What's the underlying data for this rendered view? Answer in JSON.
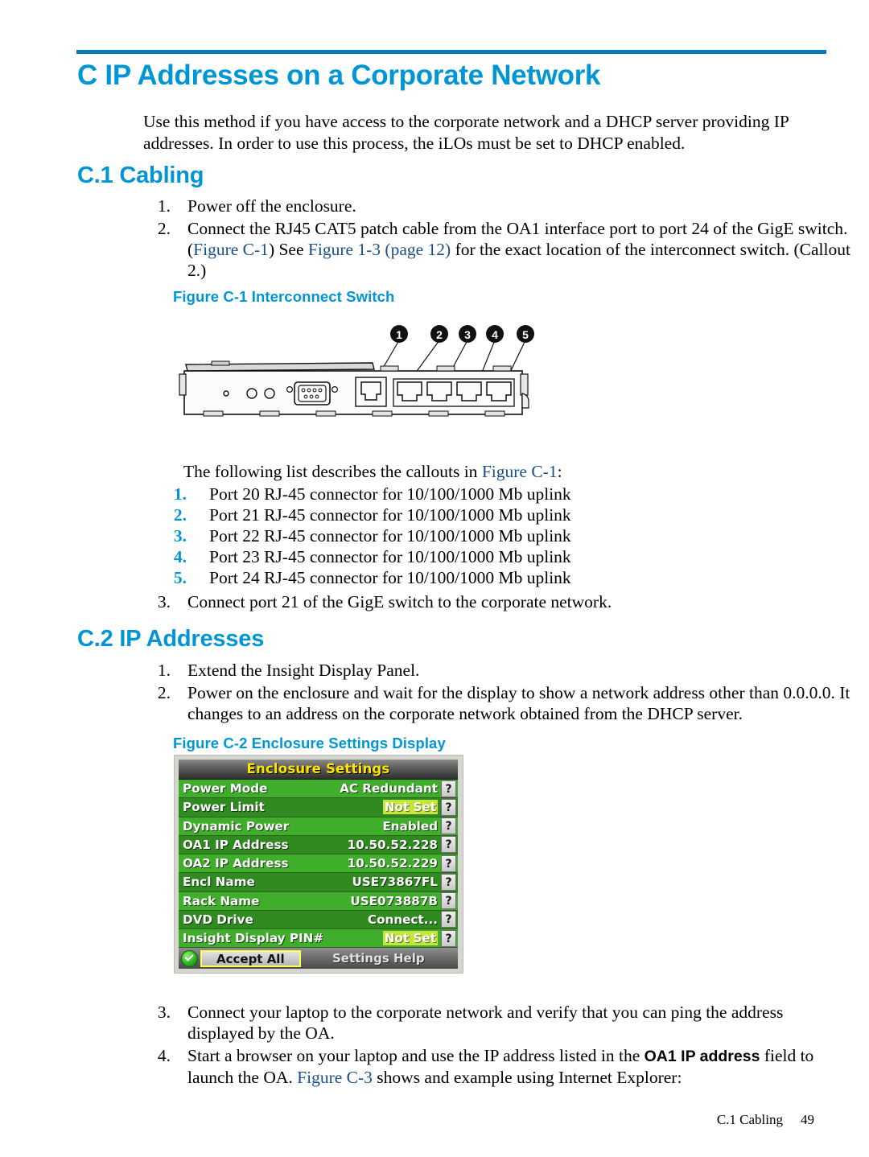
{
  "colors": {
    "heading_blue": "#0096D6",
    "rule_blue": "#0B79B8",
    "xref_blue": "#1A4F8A",
    "lcd_green_light": "#3FAE2A",
    "lcd_green_dark": "#2F8B20",
    "lcd_title_yellow": "#FFE400",
    "lcd_highlight": "#C4E63A"
  },
  "chapter": {
    "title": "C IP Addresses on a Corporate Network",
    "intro": "Use this method if you have access to the corporate network and a DHCP server providing IP addresses. In order to use this process, the iLOs must be set to DHCP enabled."
  },
  "section_cabling": {
    "heading": "C.1 Cabling",
    "steps": [
      {
        "num": "1.",
        "text": "Power off the enclosure."
      },
      {
        "num": "2.",
        "pre": "Connect the RJ45 CAT5 patch cable from the OA1 interface port to port 24 of the GigE switch. (",
        "ref1": "Figure C-1",
        "mid": ") See ",
        "ref2": "Figure 1-3 (page 12)",
        "post": " for the exact location of the interconnect switch. (Callout 2.)"
      }
    ],
    "step3": {
      "num": "3.",
      "text": "Connect port 21 of the GigE switch to the corporate network."
    }
  },
  "figure_c1": {
    "caption": "Figure C-1 Interconnect Switch",
    "callout_numbers": [
      "1",
      "2",
      "3",
      "4",
      "5"
    ],
    "intro_pre": "The following list describes the callouts in ",
    "intro_ref": "Figure C-1",
    "intro_post": ":",
    "items": [
      {
        "num": "1.",
        "text": "Port 20 RJ-45 connector for 10/100/1000 Mb uplink"
      },
      {
        "num": "2.",
        "text": "Port 21 RJ-45 connector for 10/100/1000 Mb uplink"
      },
      {
        "num": "3.",
        "text": "Port 22 RJ-45 connector for 10/100/1000 Mb uplink"
      },
      {
        "num": "4.",
        "text": "Port 23 RJ-45 connector for 10/100/1000 Mb uplink"
      },
      {
        "num": "5.",
        "text": "Port 24 RJ-45 connector for 10/100/1000 Mb uplink"
      }
    ]
  },
  "section_ip": {
    "heading": "C.2 IP Addresses",
    "steps": [
      {
        "num": "1.",
        "text": "Extend the Insight Display Panel."
      },
      {
        "num": "2.",
        "text": "Power on the enclosure and wait for the display to show a network address other than 0.0.0.0. It changes to an address on the corporate network obtained from the DHCP server."
      }
    ],
    "steps_after": [
      {
        "num": "3.",
        "text": "Connect your laptop to the corporate network and verify that you can ping the address displayed by the OA."
      },
      {
        "num": "4.",
        "pre": "Start a browser on your laptop and use the IP address listed in the ",
        "bold": "OA1 IP address",
        "mid": " field to launch the OA. ",
        "ref": "Figure C-3",
        "post": " shows and example using Internet Explorer:"
      }
    ]
  },
  "figure_c2": {
    "caption": "Figure C-2 Enclosure Settings Display",
    "panel_title": "Enclosure Settings",
    "rows": [
      {
        "label": "Power Mode",
        "value": "AC Redundant",
        "highlight": false,
        "help": "?"
      },
      {
        "label": "Power Limit",
        "value": "Not Set",
        "highlight": true,
        "help": "?"
      },
      {
        "label": "Dynamic Power",
        "value": "Enabled",
        "highlight": false,
        "help": "?"
      },
      {
        "label": "OA1 IP Address",
        "value": "10.50.52.228",
        "highlight": false,
        "help": "?"
      },
      {
        "label": "OA2 IP Address",
        "value": "10.50.52.229",
        "highlight": false,
        "help": "?"
      },
      {
        "label": "Encl Name",
        "value": "USE73867FL",
        "highlight": false,
        "help": "?"
      },
      {
        "label": "Rack Name",
        "value": "USE073887B",
        "highlight": false,
        "help": "?"
      },
      {
        "label": "DVD Drive",
        "value": "Connect...",
        "highlight": false,
        "help": "?"
      },
      {
        "label": "Insight Display PIN#",
        "value": "Not Set",
        "highlight": true,
        "help": "?"
      }
    ],
    "accept_button": "Accept All",
    "help_button": "Settings Help"
  },
  "footer": {
    "section": "C.1 Cabling",
    "page": "49"
  }
}
